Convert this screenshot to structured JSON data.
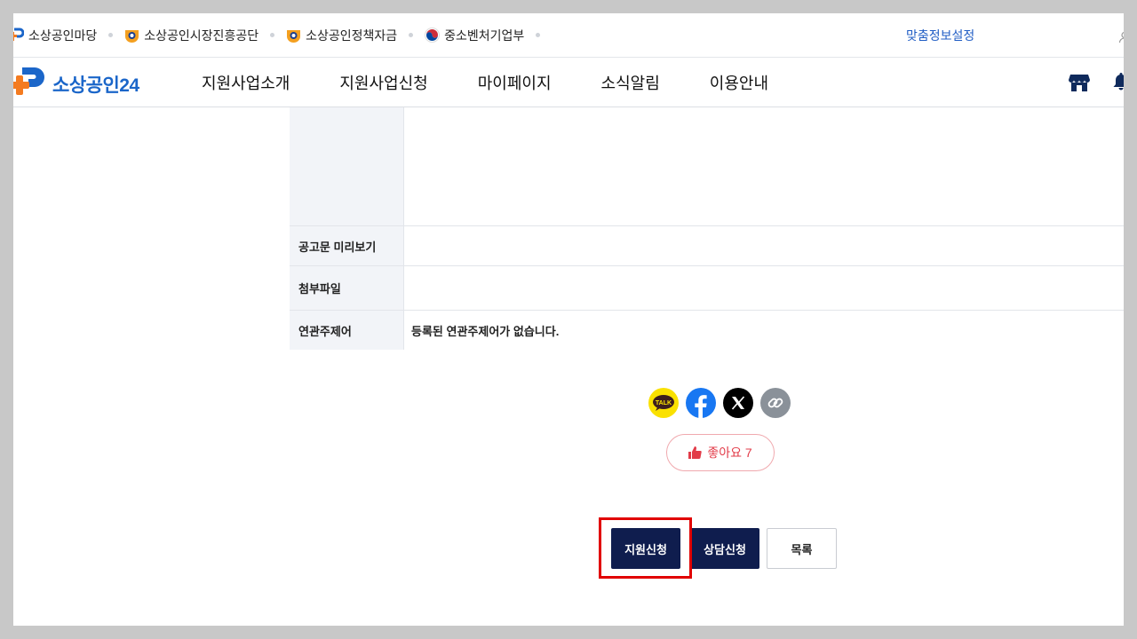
{
  "utility_bar": {
    "links": [
      {
        "label": "소상공인마당",
        "icon": "sosang-madang-icon"
      },
      {
        "label": "소상공인시장진흥공단",
        "icon": "semas-icon"
      },
      {
        "label": "소상공인정책자금",
        "icon": "policy-fund-icon"
      },
      {
        "label": "중소벤처기업부",
        "icon": "mss-taeguk-icon"
      }
    ],
    "custom_info_setting": "맞춤정보설정"
  },
  "header": {
    "logo_text": "소상공인24",
    "nav": [
      "지원사업소개",
      "지원사업신청",
      "마이페이지",
      "소식알림",
      "이용안내"
    ],
    "icons": [
      "store-icon",
      "bell-icon"
    ]
  },
  "info_table": {
    "rows": [
      {
        "label": "",
        "value": ""
      },
      {
        "label": "공고문 미리보기",
        "value": ""
      },
      {
        "label": "첨부파일",
        "value": ""
      },
      {
        "label": "연관주제어",
        "value": "등록된 연관주제어가 없습니다."
      }
    ]
  },
  "share": {
    "buttons": [
      "kakaotalk-icon",
      "facebook-icon",
      "x-icon",
      "link-icon"
    ],
    "kakao_label": "TALK"
  },
  "like": {
    "label": "좋아요",
    "count": "7"
  },
  "actions": {
    "apply": "지원신청",
    "consult": "상담신청",
    "list": "목록"
  },
  "colors": {
    "brand_blue": "#1b66c9",
    "brand_orange": "#f47b20",
    "navy_button": "#0f1d4e",
    "like_red": "#e23b48",
    "highlight_red": "#e10000"
  }
}
